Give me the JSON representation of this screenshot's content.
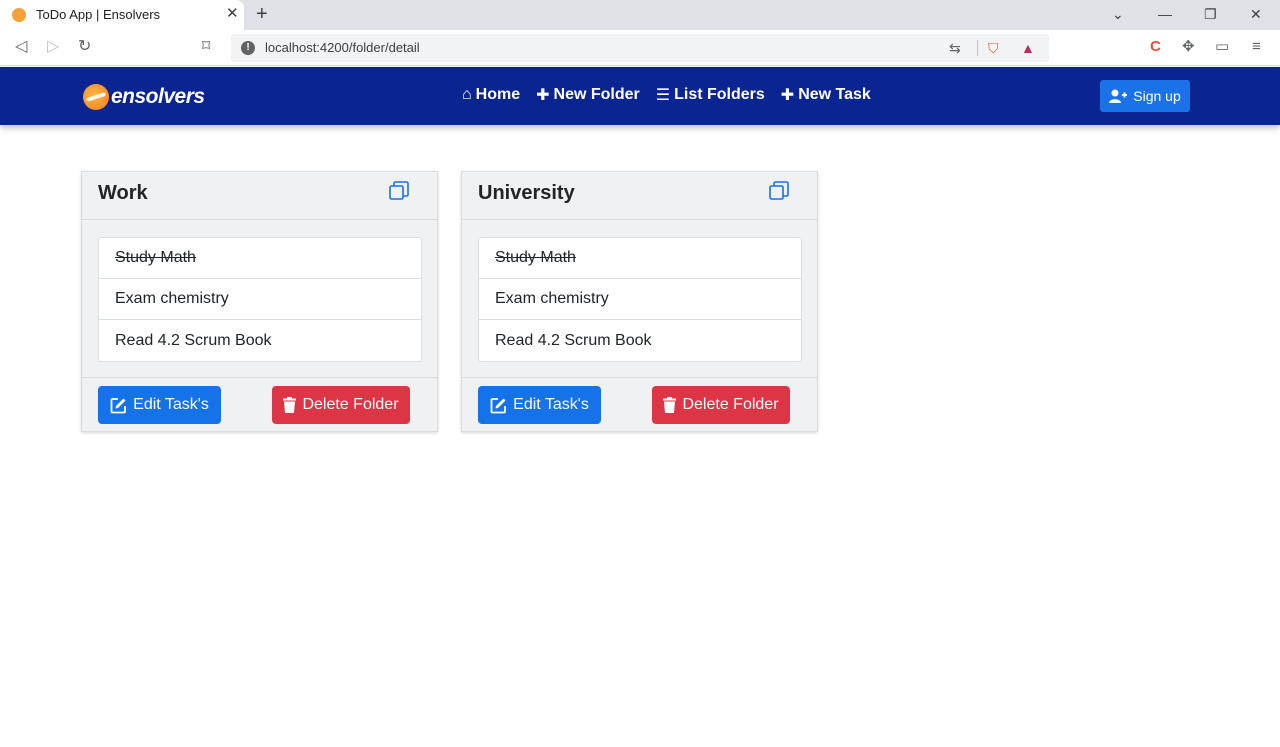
{
  "browser": {
    "tab_title": "ToDo App | Ensolvers",
    "tab_close": "✕",
    "new_tab": "+",
    "url": "localhost:4200/folder/detail"
  },
  "navbar": {
    "logo_text": "ensolvers",
    "links": [
      {
        "label": "Home",
        "icon": "home-icon"
      },
      {
        "label": "New Folder",
        "icon": "plus-icon"
      },
      {
        "label": "List Folders",
        "icon": "list-icon"
      },
      {
        "label": "New Task",
        "icon": "plus-icon"
      }
    ],
    "signup_label": "Sign up"
  },
  "folders": [
    {
      "title": "Work",
      "tasks": [
        {
          "label": "Study Math",
          "done": true
        },
        {
          "label": "Exam chemistry",
          "done": false
        },
        {
          "label": "Read 4.2 Scrum Book",
          "done": false
        }
      ],
      "edit_label": "Edit Task's",
      "delete_label": "Delete Folder"
    },
    {
      "title": "University",
      "tasks": [
        {
          "label": "Study Math",
          "done": true
        },
        {
          "label": "Exam chemistry",
          "done": false
        },
        {
          "label": "Read 4.2 Scrum Book",
          "done": false
        }
      ],
      "edit_label": "Edit Task's",
      "delete_label": "Delete Folder"
    }
  ],
  "colors": {
    "navbar": "#0a2491",
    "primary": "#1572e8",
    "danger": "#dc3545"
  }
}
